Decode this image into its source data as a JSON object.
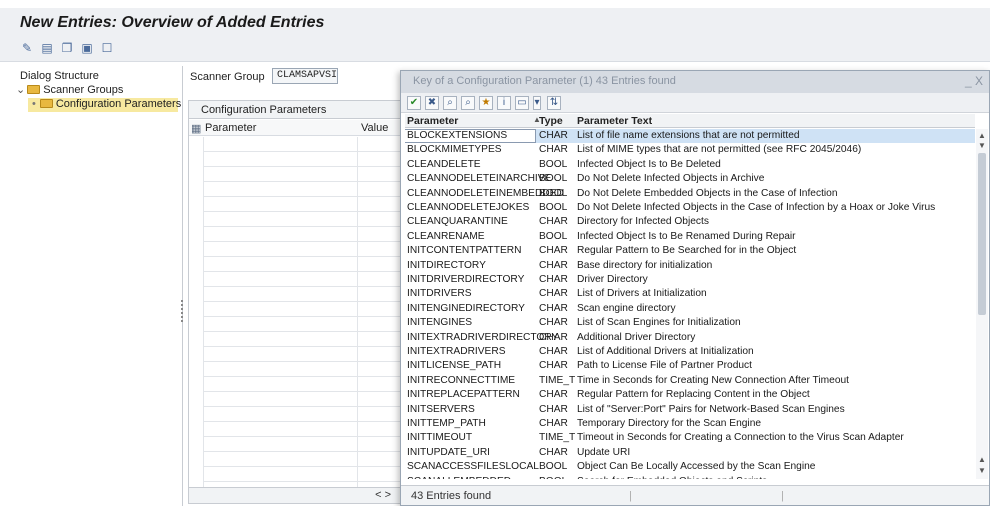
{
  "header": {
    "title": "New Entries: Overview of Added Entries"
  },
  "toolbar": {
    "icons": [
      "display-change-icon",
      "table-icon",
      "copy-icon",
      "move-icon",
      "select-icon"
    ]
  },
  "dialog_structure": {
    "title": "Dialog Structure",
    "items": [
      {
        "label": "Scanner Groups",
        "expanded": true
      },
      {
        "label": "Configuration Parameters",
        "selected": true
      }
    ]
  },
  "scanner_group": {
    "label": "Scanner Group",
    "value": "CLAMSAPVSI"
  },
  "config_table": {
    "title": "Configuration Parameters",
    "columns": [
      "Parameter",
      "Value"
    ],
    "nav": "< >"
  },
  "dialog": {
    "title": "Key of a Configuration Parameter (1)   43 Entries found",
    "close": "_ X",
    "columns": [
      "Parameter",
      "Type",
      "Parameter Text"
    ],
    "rows": [
      [
        "BLOCKEXTENSIONS",
        "CHAR",
        "List of file name extensions that are not permitted"
      ],
      [
        "BLOCKMIMETYPES",
        "CHAR",
        "List of MIME types that are not permitted (see RFC 2045/2046)"
      ],
      [
        "CLEANDELETE",
        "BOOL",
        "Infected Object Is to Be Deleted"
      ],
      [
        "CLEANNODELETEINARCHIVE",
        "BOOL",
        "Do Not Delete Infected Objects in Archive"
      ],
      [
        "CLEANNODELETEINEMBEDDED",
        "BOOL",
        "Do Not Delete Embedded Objects in the Case of Infection"
      ],
      [
        "CLEANNODELETEJOKES",
        "BOOL",
        "Do Not Delete Infected Objects in the Case of Infection by a Hoax or Joke Virus"
      ],
      [
        "CLEANQUARANTINE",
        "CHAR",
        "Directory for Infected Objects"
      ],
      [
        "CLEANRENAME",
        "BOOL",
        "Infected Object Is to Be Renamed During Repair"
      ],
      [
        "INITCONTENTPATTERN",
        "CHAR",
        "Regular Pattern to Be Searched for in the Object"
      ],
      [
        "INITDIRECTORY",
        "CHAR",
        "Base directory for initialization"
      ],
      [
        "INITDRIVERDIRECTORY",
        "CHAR",
        "Driver Directory"
      ],
      [
        "INITDRIVERS",
        "CHAR",
        "List of Drivers at Initialization"
      ],
      [
        "INITENGINEDIRECTORY",
        "CHAR",
        "Scan engine directory"
      ],
      [
        "INITENGINES",
        "CHAR",
        "List of Scan Engines for Initialization"
      ],
      [
        "INITEXTRADRIVERDIRECTORY",
        "CHAR",
        "Additional Driver Directory"
      ],
      [
        "INITEXTRADRIVERS",
        "CHAR",
        "List of Additional Drivers at Initialization"
      ],
      [
        "INITLICENSE_PATH",
        "CHAR",
        "Path to License File of Partner Product"
      ],
      [
        "INITRECONNECTTIME",
        "TIME_T",
        "Time in Seconds for Creating New Connection After Timeout"
      ],
      [
        "INITREPLACEPATTERN",
        "CHAR",
        "Regular Pattern for Replacing Content in the Object"
      ],
      [
        "INITSERVERS",
        "CHAR",
        "List of \"Server:Port\" Pairs for Network-Based Scan Engines"
      ],
      [
        "INITTEMP_PATH",
        "CHAR",
        "Temporary Directory for the Scan Engine"
      ],
      [
        "INITTIMEOUT",
        "TIME_T",
        "Timeout in Seconds for Creating a Connection to the Virus Scan Adapter"
      ],
      [
        "INITUPDATE_URI",
        "CHAR",
        "Update URI"
      ],
      [
        "SCANACCESSFILESLOCAL",
        "BOOL",
        "Object Can Be Locally Accessed by the Scan Engine"
      ],
      [
        "SCANALLEMBEDDED",
        "BOOL",
        "Search for Embedded Objects and Scripts"
      ]
    ],
    "status": "43 Entries found"
  },
  "colors": {
    "selected_row": "#cfe2f5",
    "tree_selected": "#f7e9a0",
    "folder": "#e8b840"
  }
}
